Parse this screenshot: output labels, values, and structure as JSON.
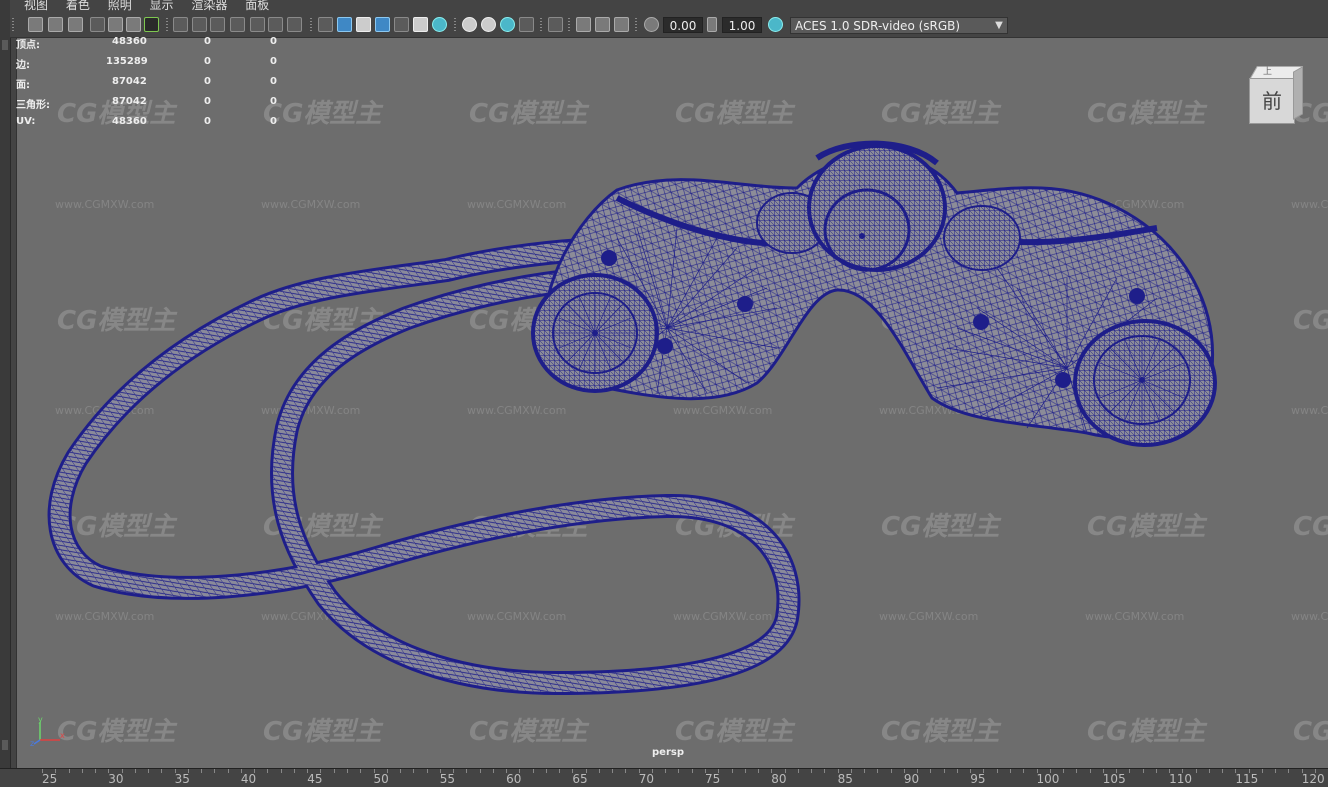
{
  "menu": [
    "视图",
    "着色",
    "照明",
    "显示",
    "渲染器",
    "面板"
  ],
  "toolbar": {
    "exposure": "0.00",
    "gamma": "1.00",
    "color_space": "ACES 1.0 SDR-video (sRGB)"
  },
  "hud": [
    {
      "label": "顶点:",
      "v1": "48360",
      "v2": "0",
      "v3": "0"
    },
    {
      "label": "边:",
      "v1": "135289",
      "v2": "0",
      "v3": "0"
    },
    {
      "label": "面:",
      "v1": "87042",
      "v2": "0",
      "v3": "0"
    },
    {
      "label": "三角形:",
      "v1": "87042",
      "v2": "0",
      "v3": "0"
    },
    {
      "label": "UV:",
      "v1": "48360",
      "v2": "0",
      "v3": "0"
    }
  ],
  "viewcube": {
    "face": "前",
    "top": "上"
  },
  "camera_label": "persp",
  "axis": {
    "x": "x",
    "y": "y",
    "z": "z"
  },
  "timeline": [
    "25",
    "30",
    "35",
    "40",
    "45",
    "50",
    "55",
    "60",
    "65",
    "70",
    "75",
    "80",
    "85",
    "90",
    "95",
    "100",
    "105",
    "110",
    "115",
    "120"
  ],
  "watermark": {
    "logo": "CG模型主",
    "url": "www.CGMXW.com"
  },
  "colors": {
    "wire": "#1e1e8a",
    "viewport_bg": "#6d6d6d",
    "accent": "#7ec850"
  }
}
